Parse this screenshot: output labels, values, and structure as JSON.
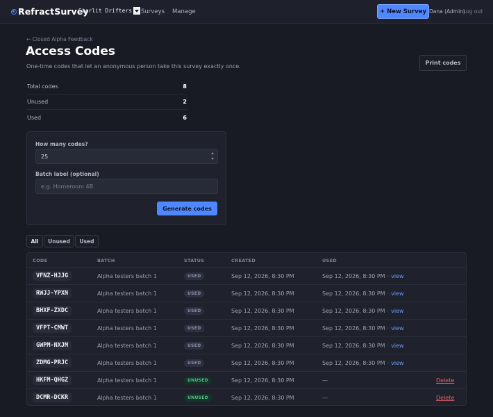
{
  "topbar": {
    "brand": "RefractSurvey",
    "org": "Starlit Drifters",
    "nav": [
      "Surveys",
      "Manage"
    ],
    "new_survey": "+ New Survey",
    "user": "Dana (Admin)",
    "logout": "Log out"
  },
  "header": {
    "back": "← Closed Alpha Feedback",
    "title": "Access Codes",
    "subtitle": "One-time codes that let an anonymous person take this survey exactly once.",
    "print": "Print codes"
  },
  "stats": [
    {
      "label": "Total codes",
      "value": "8"
    },
    {
      "label": "Unused",
      "value": "2"
    },
    {
      "label": "Used",
      "value": "6"
    }
  ],
  "generate": {
    "count_label": "How many codes?",
    "count_value": "25",
    "batch_label": "Batch label (optional)",
    "batch_placeholder": "e.g. Homeroom 4B",
    "button": "Generate codes"
  },
  "filters": [
    "All",
    "Unused",
    "Used"
  ],
  "table": {
    "columns": [
      "CODE",
      "BATCH",
      "STATUS",
      "CREATED",
      "USED"
    ],
    "rows": [
      {
        "code": "VFNZ-HJJG",
        "batch": "Alpha testers batch 1",
        "status": "USED",
        "created": "Sep 12, 2026, 8:30 PM",
        "used": "Sep 12, 2026, 8:30 PM",
        "action": "view"
      },
      {
        "code": "RWJJ-YPXN",
        "batch": "Alpha testers batch 1",
        "status": "USED",
        "created": "Sep 12, 2026, 8:30 PM",
        "used": "Sep 12, 2026, 8:30 PM",
        "action": "view"
      },
      {
        "code": "BHXF-ZXDC",
        "batch": "Alpha testers batch 1",
        "status": "USED",
        "created": "Sep 12, 2026, 8:30 PM",
        "used": "Sep 12, 2026, 8:30 PM",
        "action": "view"
      },
      {
        "code": "VFPT-CMWT",
        "batch": "Alpha testers batch 1",
        "status": "USED",
        "created": "Sep 12, 2026, 8:30 PM",
        "used": "Sep 12, 2026, 8:30 PM",
        "action": "view"
      },
      {
        "code": "GWPM-NXJM",
        "batch": "Alpha testers batch 1",
        "status": "USED",
        "created": "Sep 12, 2026, 8:30 PM",
        "used": "Sep 12, 2026, 8:30 PM",
        "action": "view"
      },
      {
        "code": "ZDMG-PRJC",
        "batch": "Alpha testers batch 1",
        "status": "USED",
        "created": "Sep 12, 2026, 8:30 PM",
        "used": "Sep 12, 2026, 8:30 PM",
        "action": "view"
      },
      {
        "code": "HKFM-QHGZ",
        "batch": "Alpha testers batch 1",
        "status": "UNUSED",
        "created": "Sep 12, 2026, 8:30 PM",
        "used": "—",
        "action": "Delete"
      },
      {
        "code": "DCMR-DCKR",
        "batch": "Alpha testers batch 1",
        "status": "UNUSED",
        "created": "Sep 12, 2026, 8:30 PM",
        "used": "—",
        "action": "Delete"
      }
    ]
  },
  "colors": {
    "accent": "#4f87ff",
    "background": "#181b24",
    "unused_badge": "#4ec48c",
    "delete": "#e0606a"
  }
}
